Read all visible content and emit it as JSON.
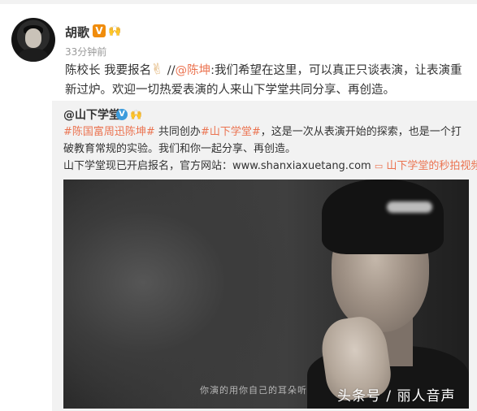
{
  "post": {
    "username": "胡歌",
    "verified_badge": "V",
    "member_badge": "🙌",
    "time": "33分钟前",
    "text_part1": "陈校长 我要报名",
    "emoji": "✌",
    "separator": " //",
    "mention": "@陈坤",
    "text_part2": ":我们希望在这里，可以真正只谈表演，让表演重新过炉。欢迎一切热爱表演的人来山下学堂共同分享、再创造。"
  },
  "repost": {
    "author": "@山下学堂",
    "verified_badge": "V",
    "member_badge": "🙌",
    "hashtag_people": "#陈国富周迅陈坤#",
    "text_a": " 共同创办",
    "hashtag_school": "#山下学堂#",
    "text_b": "，这是一次从表演开始的探索，也是一个打破教育常规的实验。我们和你一起分享、再创造。",
    "text_c": "山下学堂现已开启报名，官方网站：www.shanxiaxuetang.com ",
    "video_link_icon": "▭",
    "video_link": "山下学堂的秒拍视频"
  },
  "video": {
    "subtitle": "你演的用你自己的耳朵听"
  },
  "watermark": "头条号 / 丽人音声",
  "colors": {
    "link": "#eb7350",
    "verified_orange": "#f08c0c",
    "verified_blue": "#3b9bdc",
    "card_bg": "#f2f2f2"
  }
}
